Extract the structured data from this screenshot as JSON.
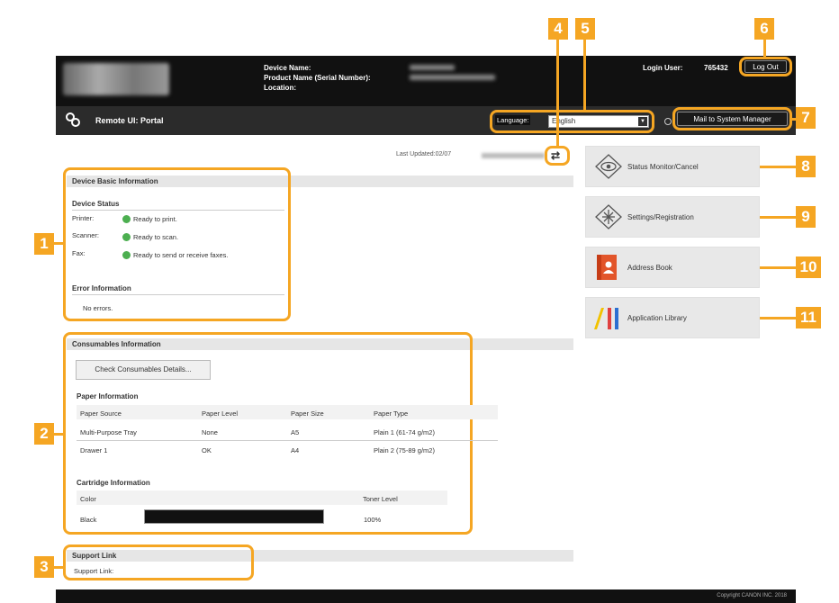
{
  "header": {
    "device_name_label": "Device Name:",
    "product_name_label": "Product Name (Serial Number):",
    "location_label": "Location:",
    "login_user_label": "Login User:",
    "login_user_value": "765432",
    "logout_label": "Log Out"
  },
  "titlebar": {
    "title": "Remote UI: Portal",
    "language_label": "Language:",
    "language_value": "English",
    "mail_button": "Mail to System Manager"
  },
  "last_updated": "Last Updated:02/07",
  "device_basic": {
    "heading": "Device Basic Information",
    "status_heading": "Device Status",
    "rows": [
      {
        "label": "Printer:",
        "value": "Ready to print."
      },
      {
        "label": "Scanner:",
        "value": "Ready to scan."
      },
      {
        "label": "Fax:",
        "value": "Ready to send or receive faxes."
      }
    ],
    "error_heading": "Error Information",
    "error_value": "No errors."
  },
  "consumables": {
    "heading": "Consumables Information",
    "check_button": "Check Consumables Details...",
    "paper_heading": "Paper Information",
    "paper_columns": [
      "Paper Source",
      "Paper Level",
      "Paper Size",
      "Paper Type"
    ],
    "paper_rows": [
      [
        "Multi-Purpose Tray",
        "None",
        "A5",
        "Plain 1 (61-74 g/m2)"
      ],
      [
        "Drawer 1",
        "OK",
        "A4",
        "Plain 2 (75-89 g/m2)"
      ]
    ],
    "cartridge_heading": "Cartridge Information",
    "cartridge_columns": [
      "Color",
      "Toner Level"
    ],
    "cartridge_rows": [
      {
        "color": "Black",
        "level": "100%",
        "level_fraction": 1.0
      }
    ]
  },
  "support": {
    "heading": "Support Link",
    "label": "Support Link:"
  },
  "tiles": [
    {
      "label": "Status Monitor/Cancel",
      "icon": "eye-icon"
    },
    {
      "label": "Settings/Registration",
      "icon": "settings-icon"
    },
    {
      "label": "Address Book",
      "icon": "address-book-icon"
    },
    {
      "label": "Application Library",
      "icon": "application-library-icon"
    }
  ],
  "markers": [
    "1",
    "2",
    "3",
    "4",
    "5",
    "6",
    "7",
    "8",
    "9",
    "10",
    "11"
  ],
  "footer": "Copyright CANON INC. 2018",
  "colors": {
    "accent": "#f5a623",
    "status_ok": "#4caf50",
    "header_bg": "#111111"
  }
}
